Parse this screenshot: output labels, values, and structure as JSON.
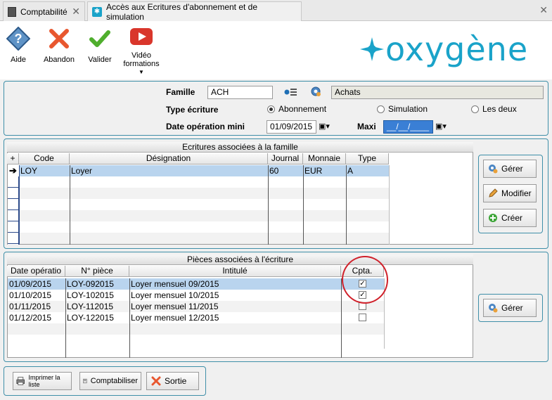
{
  "tabs": [
    {
      "label": "Comptabilité"
    },
    {
      "label": "Accès aux Ecritures d'abonnement et de simulation"
    }
  ],
  "toolbar": {
    "aide": "Aide",
    "abandon": "Abandon",
    "valider": "Valider",
    "video": "Vidéo",
    "formations": "formations"
  },
  "logo": "oxygène",
  "form": {
    "famille_label": "Famille",
    "famille_code": "ACH",
    "famille_name": "Achats",
    "type_label": "Type écriture",
    "radio_abonnement": "Abonnement",
    "radio_simulation": "Simulation",
    "radio_les_deux": "Les deux",
    "date_label": "Date opération mini",
    "date_value": "01/09/2015",
    "maxi_label": "Maxi",
    "maxi_value": "__/__/____"
  },
  "ecritures": {
    "title": "Ecritures associées à la famille",
    "headers": {
      "code": "Code",
      "designation": "Désignation",
      "journal": "Journal",
      "monnaie": "Monnaie",
      "type": "Type"
    },
    "rows": [
      {
        "code": "LOY",
        "designation": "Loyer",
        "journal": "60",
        "monnaie": "EUR",
        "type": "A"
      }
    ],
    "buttons": {
      "gerer": "Gérer",
      "modifier": "Modifier",
      "creer": "Créer"
    }
  },
  "pieces": {
    "title": "Pièces associées à l'écriture",
    "headers": {
      "date": "Date opératio",
      "piece": "N° pièce",
      "intitule": "Intitulé",
      "cpta": "Cpta."
    },
    "rows": [
      {
        "date": "01/09/2015",
        "piece": "LOY-092015",
        "intitule": "Loyer mensuel 09/2015",
        "cpta": true
      },
      {
        "date": "01/10/2015",
        "piece": "LOY-102015",
        "intitule": "Loyer mensuel 10/2015",
        "cpta": true
      },
      {
        "date": "01/11/2015",
        "piece": "LOY-112015",
        "intitule": "Loyer mensuel 11/2015",
        "cpta": false
      },
      {
        "date": "01/12/2015",
        "piece": "LOY-122015",
        "intitule": "Loyer mensuel 12/2015",
        "cpta": false
      }
    ],
    "gerer": "Gérer"
  },
  "footer": {
    "imprimer": "Imprimer la liste",
    "comptabiliser": "Comptabiliser",
    "sortie": "Sortie"
  },
  "colors": {
    "accent": "#3f8fa8",
    "selected_row": "#b9d4ee",
    "highlight_circle": "#d0202a",
    "logo": "#1aa3c9"
  }
}
